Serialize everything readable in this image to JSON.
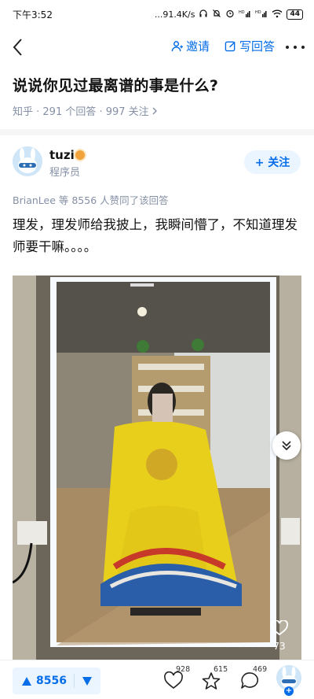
{
  "status_bar": {
    "time": "下午3:52",
    "network_speed": "...91.4K/s",
    "battery": "44"
  },
  "nav": {
    "invite_label": "邀请",
    "write_answer_label": "写回答"
  },
  "question": {
    "title": "说说你见过最离谱的事是什么?",
    "meta": "知乎 · 291 个回答 · 997 关注"
  },
  "author": {
    "name": "tuzi",
    "bio": "程序员",
    "follow_label": "+ 关注"
  },
  "answer": {
    "upvoters": "BrianLee 等 8556 人赞同了该回答",
    "text": "理发，理发师给我披上，我瞬间懵了，不知道理发师要干嘛。。。。",
    "image_like_count": "73"
  },
  "bottom_bar": {
    "upvote_count": "8556",
    "like_count": "928",
    "favorite_count": "615",
    "comment_count": "469"
  },
  "colors": {
    "accent": "#056de8",
    "accent_bg": "#ebf5ff",
    "muted_text": "#8590a6"
  }
}
